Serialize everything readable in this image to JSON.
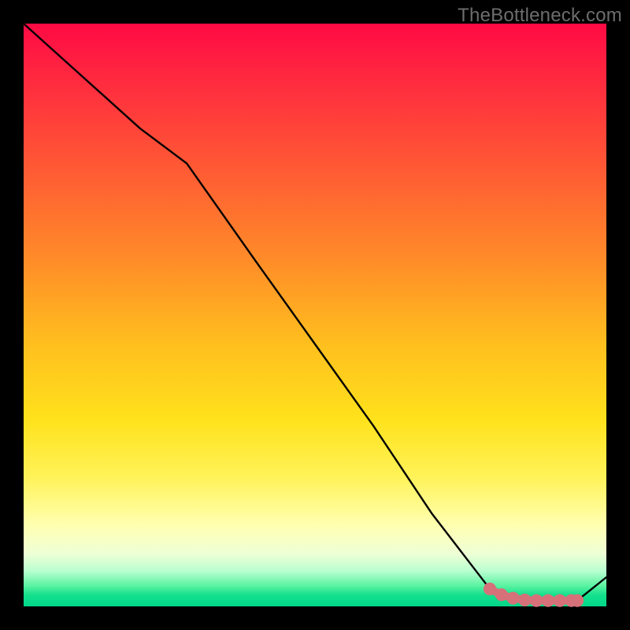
{
  "watermark": "TheBottleneck.com",
  "chart_data": {
    "type": "line",
    "title": "",
    "xlabel": "",
    "ylabel": "",
    "xlim": [
      0,
      100
    ],
    "ylim": [
      0,
      100
    ],
    "series": [
      {
        "name": "curve",
        "color": "#000000",
        "x": [
          0,
          10,
          20,
          28,
          40,
          50,
          60,
          70,
          80,
          85,
          90,
          92,
          95,
          100
        ],
        "y": [
          100,
          91,
          82,
          76,
          59,
          45,
          31,
          16,
          3,
          1,
          1,
          1,
          1,
          5
        ]
      }
    ],
    "highlight": {
      "points_x": [
        80,
        82,
        84,
        86,
        88,
        90,
        92,
        94,
        95
      ],
      "points_y": [
        3,
        2,
        1.4,
        1.1,
        1,
        1,
        1,
        1,
        1
      ],
      "color": "#d6717a",
      "radius_frac": 0.011
    }
  }
}
